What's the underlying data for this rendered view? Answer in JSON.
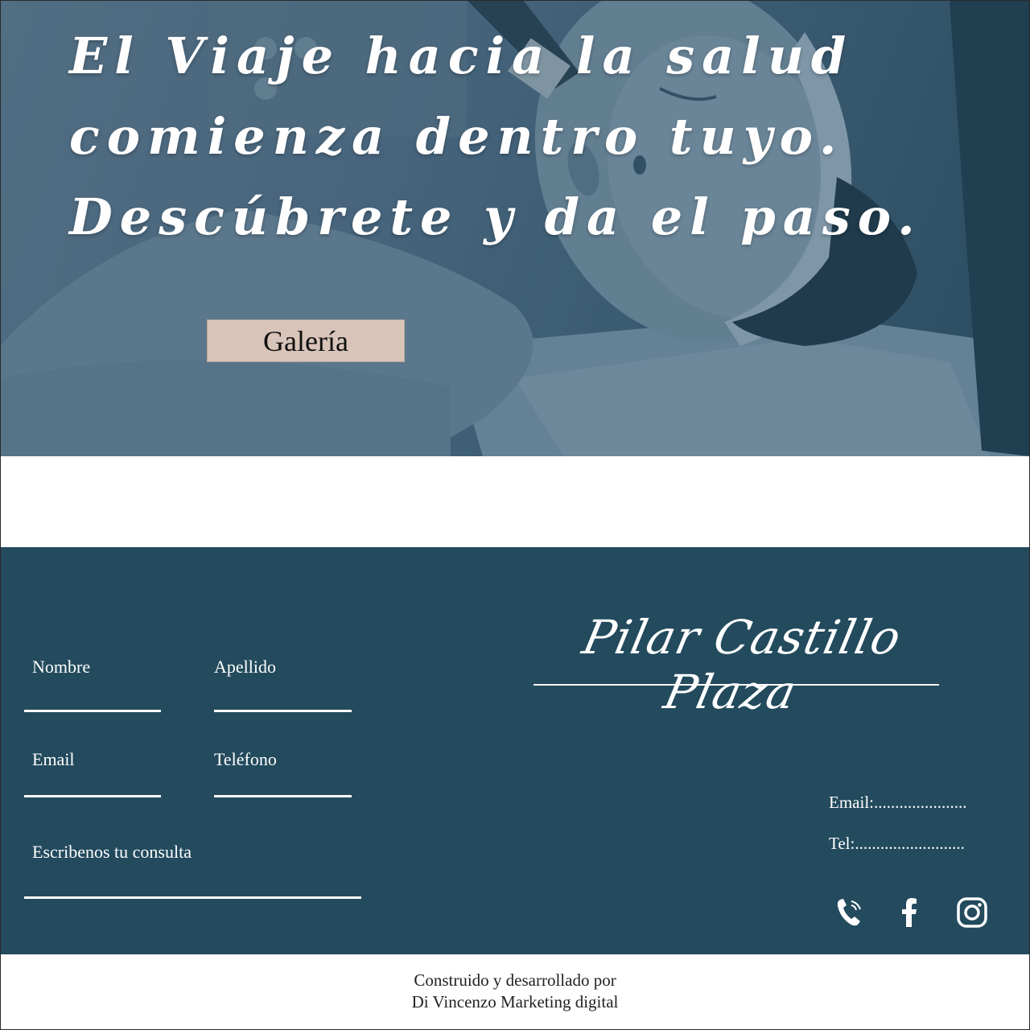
{
  "hero": {
    "title_lines": [
      "El Viaje hacia la salud",
      "comienza dentro tuyo.",
      "Descúbrete y da el paso."
    ],
    "gallery_button_label": "Galería"
  },
  "contact_form": {
    "first_name_label": "Nombre",
    "last_name_label": "Apellido",
    "email_label": "Email",
    "phone_label": "Teléfono",
    "message_label": "Escribenos tu consulta"
  },
  "brand": {
    "signature": "Pilar Castillo Plaza"
  },
  "contact_info": {
    "email_line": "Email:......................",
    "phone_line": "Tel:.........................."
  },
  "social": {
    "icons": [
      "phone-icon",
      "facebook-icon",
      "instagram-icon"
    ]
  },
  "footer": {
    "credit_line_1": "Construido y desarrollado por",
    "credit_line_2": "Di Vincenzo Marketing digital"
  },
  "colors": {
    "navy": "#234a5d",
    "button_beige": "#d8c4b8",
    "text_white": "#ffffff"
  }
}
